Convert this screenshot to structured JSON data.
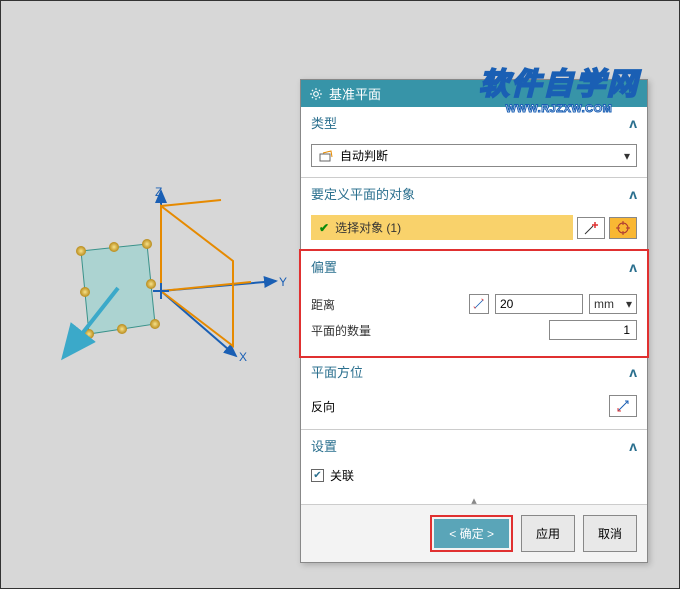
{
  "watermark": {
    "big": "软件自学网",
    "url": "WWW.RJZXW.COM"
  },
  "panel": {
    "title": "基准平面"
  },
  "sections": {
    "type": {
      "title": "类型",
      "option": "自动判断"
    },
    "objects": {
      "title": "要定义平面的对象",
      "sel_label": "选择对象 (1)"
    },
    "offset": {
      "title": "偏置",
      "dist_label": "距离",
      "dist_value": "20",
      "unit": "mm",
      "count_label": "平面的数量",
      "count_value": "1"
    },
    "orient": {
      "title": "平面方位",
      "reverse": "反向"
    },
    "settings": {
      "title": "设置",
      "assoc": "关联"
    }
  },
  "buttons": {
    "ok": "< 确定 >",
    "apply": "应用",
    "cancel": "取消"
  },
  "axes": {
    "x": "X",
    "y": "Y",
    "z": "Z"
  }
}
